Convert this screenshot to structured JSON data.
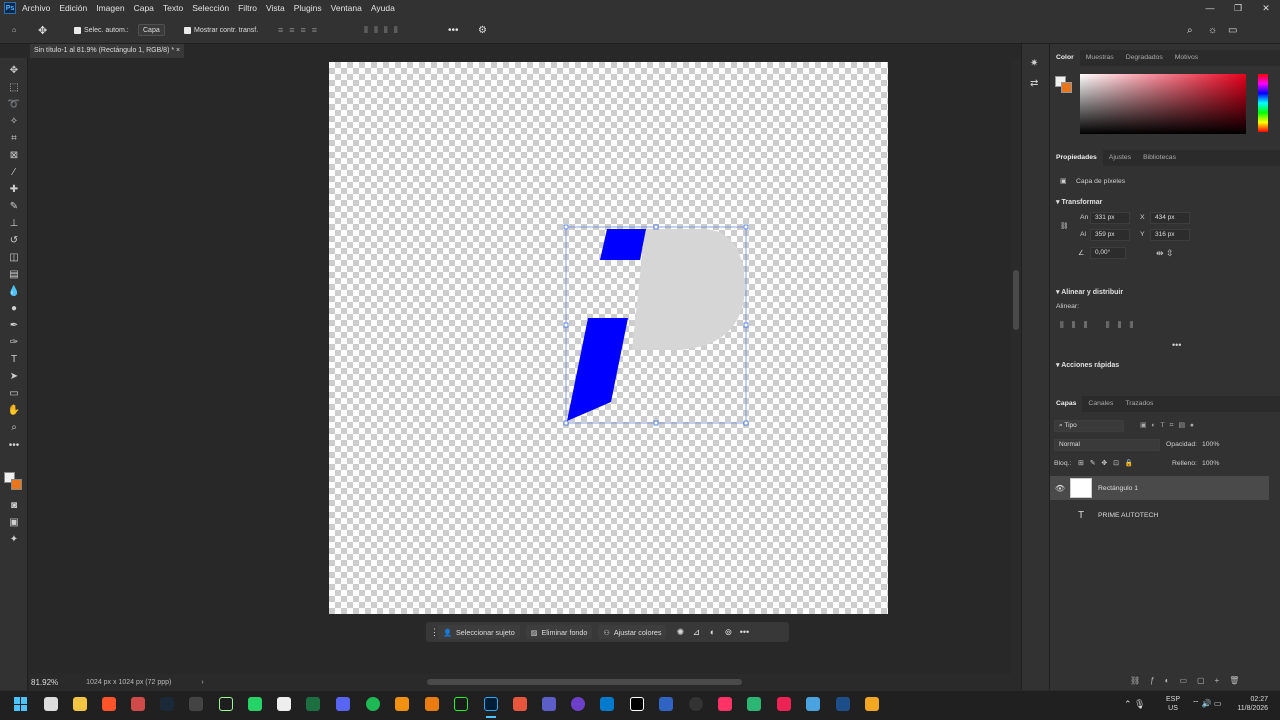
{
  "menu": [
    "Archivo",
    "Edición",
    "Imagen",
    "Capa",
    "Texto",
    "Selección",
    "Filtro",
    "Vista",
    "Plugins",
    "Ventana",
    "Ayuda"
  ],
  "options": {
    "auto_select": "Selec. autom.:",
    "auto_select_value": "Capa",
    "show_transform": "Mostrar contr. transf."
  },
  "document_tab": "Sin título-1 al 81.9% (Rectángulo 1, RGB/8) *",
  "status": {
    "zoom": "81.92%",
    "doc_info": "1024 px x 1024 px (72 ppp)"
  },
  "context_bar": {
    "select_subject": "Seleccionar sujeto",
    "remove_bg": "Eliminar fondo",
    "adjust_colors": "Ajustar colores"
  },
  "color_panel": {
    "tabs": [
      "Color",
      "Muestras",
      "Degradados",
      "Motivos"
    ]
  },
  "properties_panel": {
    "tabs": [
      "Propiedades",
      "Ajustes",
      "Bibliotecas"
    ],
    "layer_type": "Capa de píxeles",
    "transform_title": "Transformar",
    "w_label": "An",
    "w": "331 px",
    "h_label": "Al",
    "h": "359 px",
    "x_label": "X",
    "x": "434 px",
    "y_label": "Y",
    "y": "316 px",
    "angle": "0,00°",
    "align_title": "Alinear y distribuir",
    "align_label": "Alinear:",
    "quick_actions": "Acciones rápidas"
  },
  "layers_panel": {
    "tabs": [
      "Capas",
      "Canales",
      "Trazados"
    ],
    "filter": "Tipo",
    "blend": "Normal",
    "opacity_label": "Opacidad:",
    "opacity": "100%",
    "lock_label": "Bloq.:",
    "fill_label": "Relleno:",
    "fill": "100%",
    "layers": [
      {
        "name": "Rectángulo 1",
        "selected": true
      },
      {
        "name": "PRIME AUTOTECH",
        "selected": false
      }
    ]
  },
  "clock": {
    "lang1": "ESP",
    "lang2": "US",
    "time": "02:27",
    "date": "11/8/2026"
  },
  "colors": {
    "fg": "#f0f0f0",
    "bg": "#e8761a",
    "logo_blue": "#0000ff",
    "logo_grey": "#d6d6d6"
  }
}
